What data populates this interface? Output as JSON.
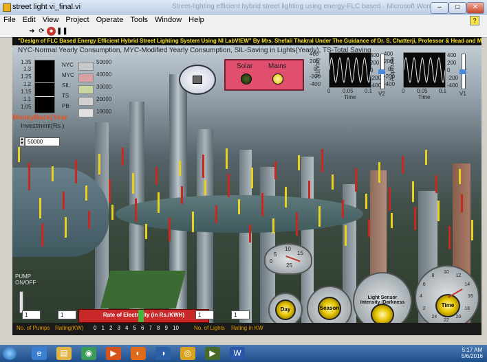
{
  "window": {
    "title": "street light vi_final.vi",
    "blurred_text": "Street-lighting efficient hybrid street lighting using energy-FLC based  ·  Microsoft Word"
  },
  "menu": [
    "File",
    "Edit",
    "View",
    "Project",
    "Operate",
    "Tools",
    "Window",
    "Help"
  ],
  "banner": "\"Design of FLC Based Energy Efficient Hybrid Street Lighting  System Using NI LabVIEW\" By Mrs. Shefali Thakral Under The Guidance of Dr. S. Chatterji, Professor & Head and Mrs. Shimi S.L, Asst. Professor, EED,  NITTTR",
  "legend": "NYC-Normal Yearly Consumption, MYC-Modified Yearly Consumption, SIL-Saving in Lights(Yearly), TS-Total Saving",
  "tank_scale": [
    "1.35",
    "1.3",
    "1.25",
    "1.2",
    "1.15",
    "1.1",
    "1.05"
  ],
  "bar_labels": [
    "NYC",
    "MYC",
    "SIL",
    "TS",
    "PB"
  ],
  "bar_axis": [
    "50000",
    "40000",
    "30000",
    "20000",
    "10000"
  ],
  "moneyback": "MoneyBack(Year",
  "investment": {
    "label": "Investment(Rs.)",
    "value": "50000"
  },
  "source": {
    "solar": "Solar",
    "mains": "Mains"
  },
  "scope1": {
    "yaxis": [
      "400",
      "200",
      "0",
      "-200",
      "-400"
    ],
    "xaxis": [
      "0",
      "0.05",
      "0.1"
    ],
    "ylabel": "V1(Volt)",
    "xlabel": "Time",
    "slider_ticks": [
      "400",
      "200",
      "0",
      "-200",
      "-400"
    ],
    "slider_name": "V2"
  },
  "scope2": {
    "yaxis": [
      "400",
      "200",
      "0",
      "-200",
      "-400"
    ],
    "xaxis": [
      "0",
      "0.05",
      "0.1"
    ],
    "ylabel": "Amplitude",
    "xlabel": "Time",
    "slider_ticks": [
      "400",
      "200",
      "0",
      "-200",
      "-400"
    ],
    "slider_name": "V1"
  },
  "pump": "PUMP\nON/OFF",
  "controls": {
    "pumps_value": "1",
    "rating_value": "1",
    "lights_value": "1",
    "lights_rating_value": "1"
  },
  "rate_label": "Rate of Electricity (in Rs./KWH)",
  "rate_ticks": [
    "0",
    "1",
    "2",
    "3",
    "4",
    "5",
    "6",
    "7",
    "8",
    "9",
    "10"
  ],
  "bottom_labels": {
    "pumps": "No. of Pumps",
    "rating": "Rating(KW)",
    "lights": "No. of Lights",
    "lights_rating": "Rating in KW"
  },
  "gauge_small": [
    "10",
    "15",
    "5",
    "0",
    "25"
  ],
  "knobs": {
    "day": "Day",
    "season": "Season",
    "light_sensor": "Light Sensor Intensity (Darkness in %)",
    "time": "Time"
  },
  "time_dial_ticks": [
    "10",
    "12",
    "14",
    "16",
    "18",
    "20",
    "22",
    "24",
    "2",
    "4",
    "6",
    "8"
  ],
  "taskbar": {
    "time": "5:17 AM",
    "date": "5/6/2016"
  }
}
